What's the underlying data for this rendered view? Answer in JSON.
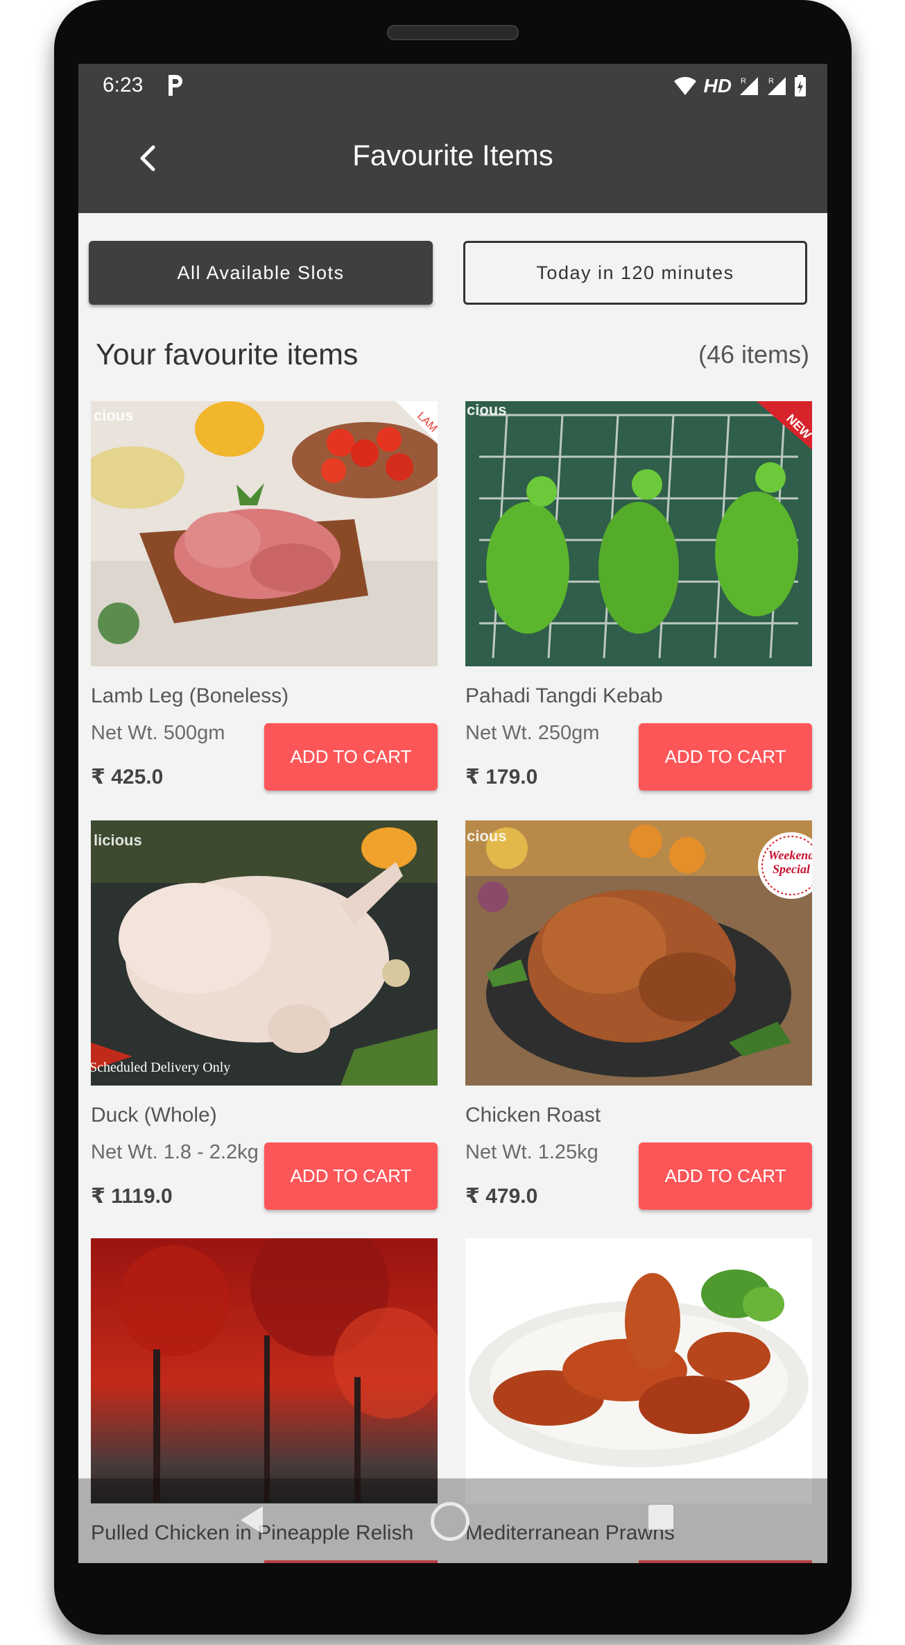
{
  "status_bar": {
    "time": "6:23",
    "network_label": "HD",
    "roaming_1": "R",
    "roaming_2": "R"
  },
  "app_bar": {
    "title": "Favourite Items"
  },
  "slots": {
    "all": "All Available Slots",
    "today": "Today in 120 minutes"
  },
  "section": {
    "title": "Your favourite items",
    "count": "(46 items)"
  },
  "items": [
    {
      "name": "Lamb Leg (Boneless)",
      "weight": "Net Wt. 500gm",
      "price": "₹ 425.0",
      "cta": "ADD TO CART",
      "image_text": "cious",
      "ribbon": "LAM"
    },
    {
      "name": "Pahadi Tangdi Kebab",
      "weight": "Net Wt. 250gm",
      "price": "₹ 179.0",
      "cta": "ADD TO CART",
      "image_text": "cious",
      "ribbon": "NEW"
    },
    {
      "name": "Duck (Whole)",
      "weight": "Net Wt. 1.8 - 2.2kg",
      "price": "₹ 1119.0",
      "cta": "ADD TO CART",
      "image_text": "licious",
      "caption": "Scheduled Delivery Only"
    },
    {
      "name": "Chicken Roast",
      "weight": "Net Wt. 1.25kg",
      "price": "₹ 479.0",
      "cta": "ADD TO CART",
      "image_text": "cious",
      "badge": "Weekend Special"
    },
    {
      "name": "Pulled Chicken in Pineapple Relish"
    },
    {
      "name": "Mediterranean Prawns"
    }
  ],
  "colors": {
    "accent": "#fd5659",
    "bar": "#3f3f3f",
    "background": "#f3f3f3"
  }
}
